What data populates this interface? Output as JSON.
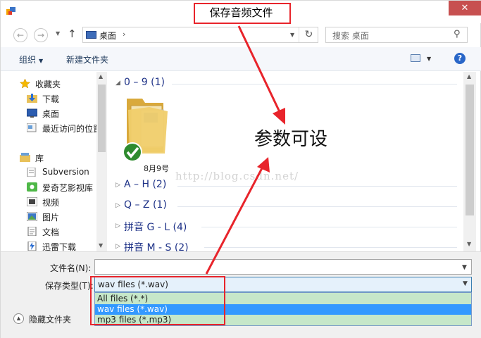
{
  "window": {
    "title": "保存音频文件",
    "close_glyph": "✕"
  },
  "nav": {
    "back_glyph": "←",
    "forward_glyph": "→",
    "up_glyph": "↑",
    "address": "桌面",
    "address_chevron": "›",
    "refresh_glyph": "↻",
    "search_placeholder": "搜索 桌面",
    "search_glyph": "⚲"
  },
  "toolbar": {
    "organize": "组织",
    "new_folder": "新建文件夹",
    "help": "?"
  },
  "sidebar": {
    "favorites": "收藏夹",
    "items_fav": [
      "下载",
      "桌面",
      "最近访问的位置"
    ],
    "library": "库",
    "items_lib": [
      "Subversion",
      "爱奇艺影视库",
      "视频",
      "图片",
      "文档",
      "迅雷下载"
    ]
  },
  "content": {
    "groups": [
      "0 – 9 (1)",
      "A – H (2)",
      "Q – Z (1)",
      "拼音 G - L (4)",
      "拼音 M - S (2)"
    ],
    "folder_name": "8月9号"
  },
  "form": {
    "filename_label": "文件名(N):",
    "filename_value": "",
    "filetype_label": "保存类型(T):",
    "filetype_value": "wav files (*.wav)",
    "filetype_options": [
      "All files (*.*)",
      "wav files (*.wav)",
      "mp3 files (*.mp3)"
    ],
    "hide_folders": "隐藏文件夹"
  },
  "overlay": {
    "annotation": "参数可设",
    "watermark": "http://blog.csdn.net/"
  },
  "colors": {
    "accent": "#3399ff",
    "annotation_red": "#e8242b",
    "list_bg": "#c6e7c9"
  }
}
